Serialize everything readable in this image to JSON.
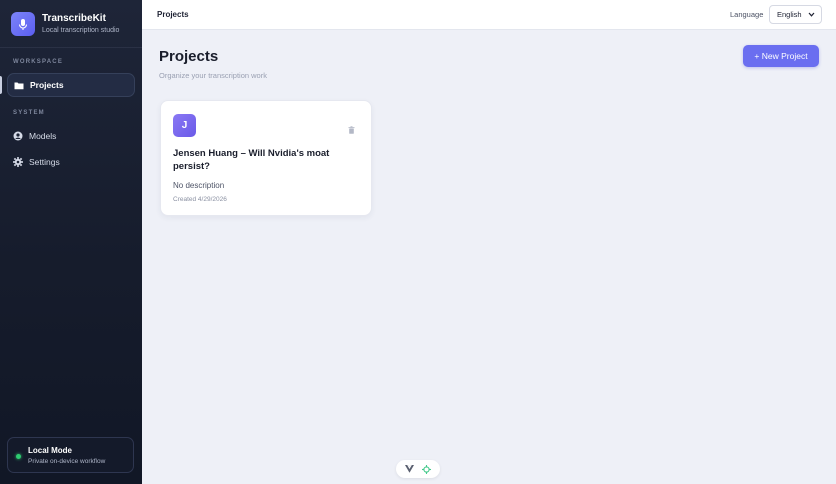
{
  "app": {
    "title": "TranscribeKit",
    "subtitle": "Local transcription studio",
    "logo_icon": "microphone-icon",
    "accent": "#6a6ef0"
  },
  "sidebar": {
    "workspace_label": "WORKSPACE",
    "system_label": "SYSTEM",
    "items": [
      {
        "label": "Projects",
        "icon": "folder-icon",
        "active": true
      },
      {
        "label": "Models",
        "icon": "models-icon",
        "active": false
      },
      {
        "label": "Settings",
        "icon": "gear-icon",
        "active": false
      }
    ],
    "local_mode": {
      "title": "Local Mode",
      "subtitle": "Private on-device workflow",
      "status_color": "#2ecc71"
    }
  },
  "topbar": {
    "breadcrumb": "Projects",
    "language_label": "Language",
    "language_value": "English"
  },
  "main": {
    "title": "Projects",
    "subtitle": "Organize your transcription work",
    "new_button": "+ New Project",
    "projects": [
      {
        "initial": "J",
        "title": "Jensen Huang – Will Nvidia's moat persist?",
        "description": "No description",
        "created": "Created 4/29/2026"
      }
    ]
  },
  "bottom_toolbar": {
    "icons": [
      "vue-devtools-icon",
      "inspector-icon"
    ]
  }
}
